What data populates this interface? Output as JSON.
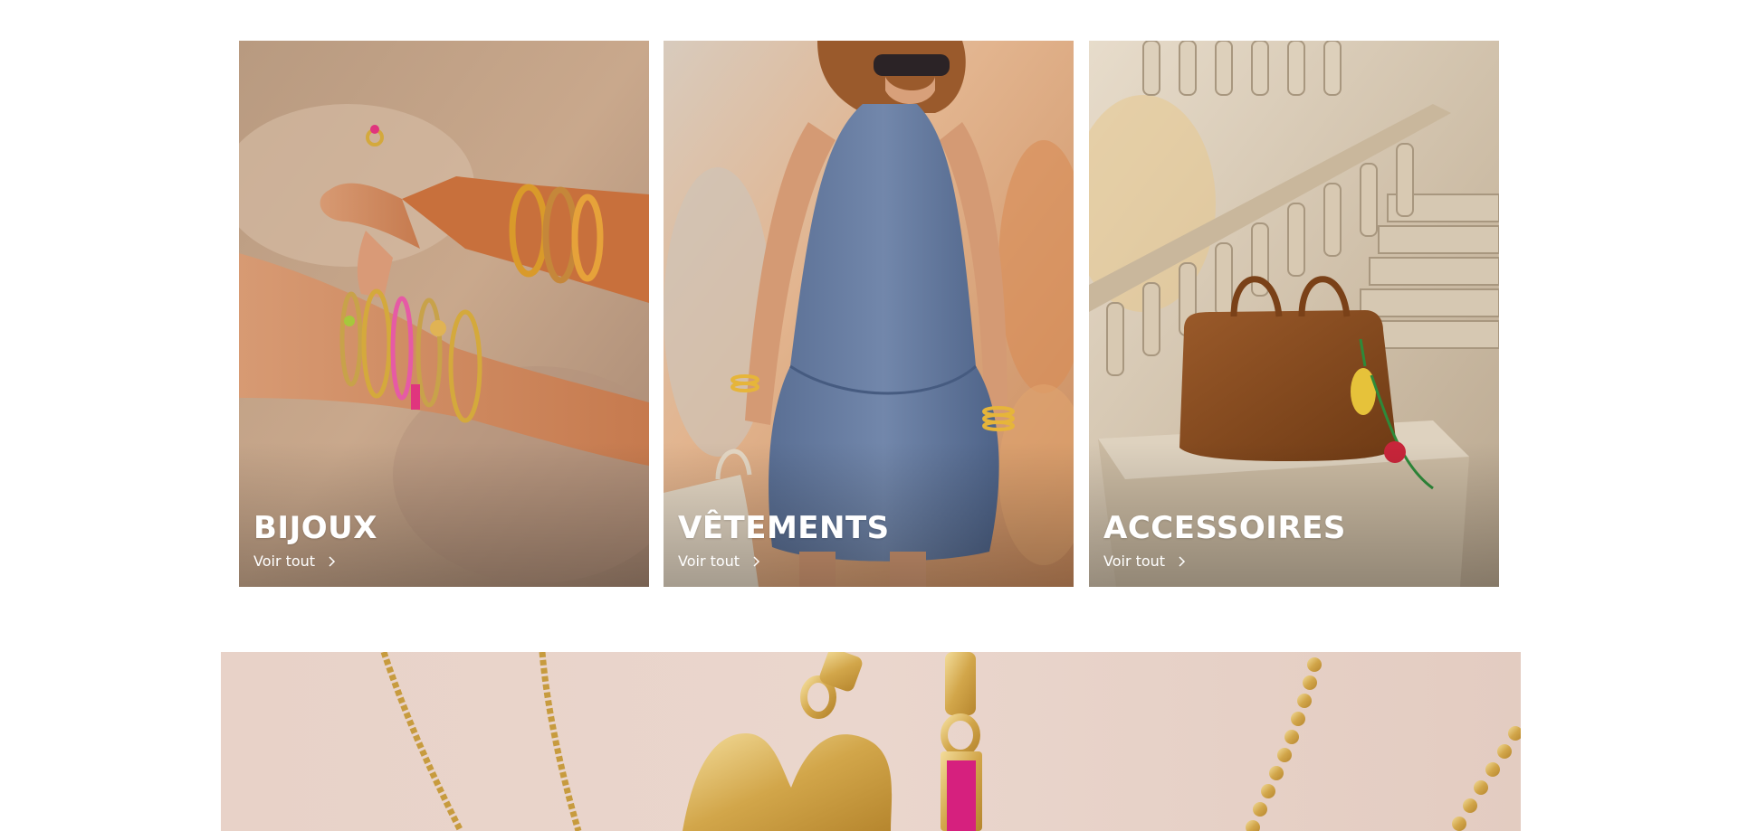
{
  "categories": [
    {
      "title": "BIJOUX",
      "link_label": "Voir tout",
      "photo_icon": "bracelets-on-wrist-photo"
    },
    {
      "title": "VÊTEMENTS",
      "link_label": "Voir tout",
      "photo_icon": "denim-dress-model-photo"
    },
    {
      "title": "ACCESSOIRES",
      "link_label": "Voir tout",
      "photo_icon": "suede-handbag-staircase-photo"
    }
  ],
  "banner": {
    "photo_icon": "gold-necklaces-pendants-photo"
  },
  "colors": {
    "text_on_image": "#ffffff",
    "page_background": "#ffffff"
  }
}
